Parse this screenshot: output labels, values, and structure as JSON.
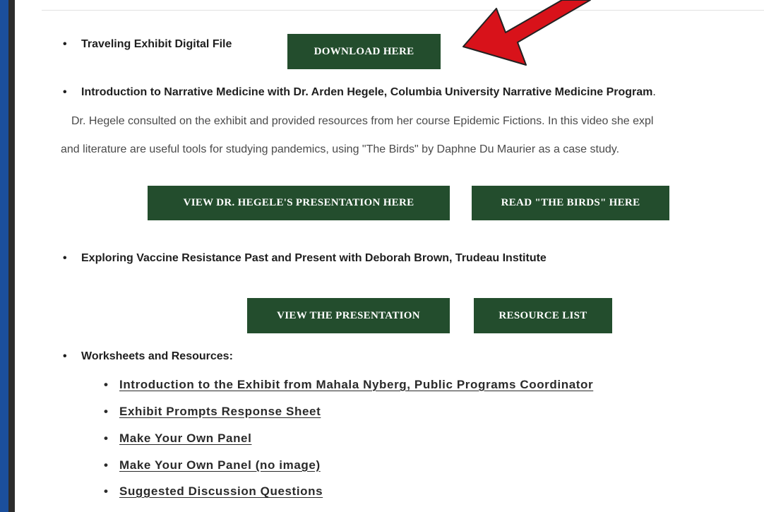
{
  "items": {
    "traveling_exhibit": "Traveling Exhibit Digital File",
    "narrative_medicine": "Introduction to Narrative Medicine with Dr. Arden Hegele, Columbia University Narrative Medicine Program",
    "narrative_medicine_period": ".",
    "paragraph_line1": "Dr. Hegele consulted on the exhibit and provided resources from her course Epidemic Fictions.  In this video she expl",
    "paragraph_line2": "and literature are useful tools for studying pandemics, using \"The Birds\" by Daphne Du Maurier as a case study.",
    "vaccine_resistance": "Exploring Vaccine Resistance Past and Present with Deborah Brown, Trudeau Institute",
    "worksheets": "Worksheets and Resources:"
  },
  "buttons": {
    "download": "DOWNLOAD HERE",
    "view_hegele": "VIEW DR. HEGELE'S PRESENTATION HERE",
    "read_birds": "READ \"THE BIRDS\" HERE",
    "view_presentation": "VIEW THE PRESENTATION",
    "resource_list": "RESOURCE LIST"
  },
  "links": [
    "Introduction to the Exhibit from Mahala Nyberg, Public Programs Coordinator",
    "Exhibit Prompts Response Sheet",
    "Make Your Own Panel",
    "Make Your Own Panel (no image)",
    "Suggested Discussion Questions"
  ],
  "bullet_glyph": "•",
  "colors": {
    "button_bg": "#234d2d",
    "arrow": "#d8121a",
    "frame": "#1b4f9c"
  }
}
